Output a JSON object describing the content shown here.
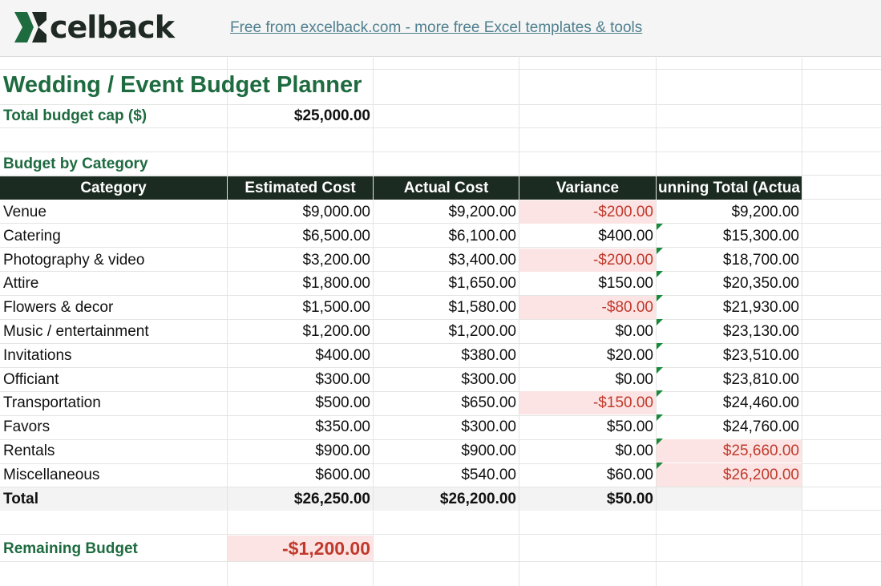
{
  "header": {
    "logo_text": "celback",
    "link_text": "Free from excelback.com - more free Excel templates & tools"
  },
  "sheet": {
    "title": "Wedding / Event Budget Planner",
    "cap_label": "Total budget cap ($)",
    "cap_value": "$25,000.00",
    "section_label": "Budget by Category",
    "columns": [
      "Category",
      "Estimated Cost",
      "Actual Cost",
      "Variance",
      "unning Total (Actua"
    ],
    "rows": [
      {
        "category": "Venue",
        "estimated": "$9,000.00",
        "actual": "$9,200.00",
        "variance": "-$200.00",
        "running": "$9,200.00",
        "var_neg": true,
        "run_over": false
      },
      {
        "category": "Catering",
        "estimated": "$6,500.00",
        "actual": "$6,100.00",
        "variance": "$400.00",
        "running": "$15,300.00",
        "var_neg": false,
        "run_over": false
      },
      {
        "category": "Photography & video",
        "estimated": "$3,200.00",
        "actual": "$3,400.00",
        "variance": "-$200.00",
        "running": "$18,700.00",
        "var_neg": true,
        "run_over": false
      },
      {
        "category": "Attire",
        "estimated": "$1,800.00",
        "actual": "$1,650.00",
        "variance": "$150.00",
        "running": "$20,350.00",
        "var_neg": false,
        "run_over": false
      },
      {
        "category": "Flowers & decor",
        "estimated": "$1,500.00",
        "actual": "$1,580.00",
        "variance": "-$80.00",
        "running": "$21,930.00",
        "var_neg": true,
        "run_over": false
      },
      {
        "category": "Music / entertainment",
        "estimated": "$1,200.00",
        "actual": "$1,200.00",
        "variance": "$0.00",
        "running": "$23,130.00",
        "var_neg": false,
        "run_over": false
      },
      {
        "category": "Invitations",
        "estimated": "$400.00",
        "actual": "$380.00",
        "variance": "$20.00",
        "running": "$23,510.00",
        "var_neg": false,
        "run_over": false
      },
      {
        "category": "Officiant",
        "estimated": "$300.00",
        "actual": "$300.00",
        "variance": "$0.00",
        "running": "$23,810.00",
        "var_neg": false,
        "run_over": false
      },
      {
        "category": "Transportation",
        "estimated": "$500.00",
        "actual": "$650.00",
        "variance": "-$150.00",
        "running": "$24,460.00",
        "var_neg": true,
        "run_over": false
      },
      {
        "category": "Favors",
        "estimated": "$350.00",
        "actual": "$300.00",
        "variance": "$50.00",
        "running": "$24,760.00",
        "var_neg": false,
        "run_over": false
      },
      {
        "category": "Rentals",
        "estimated": "$900.00",
        "actual": "$900.00",
        "variance": "$0.00",
        "running": "$25,660.00",
        "var_neg": false,
        "run_over": true
      },
      {
        "category": "Miscellaneous",
        "estimated": "$600.00",
        "actual": "$540.00",
        "variance": "$60.00",
        "running": "$26,200.00",
        "var_neg": false,
        "run_over": true
      }
    ],
    "total": {
      "label": "Total",
      "estimated": "$26,250.00",
      "actual": "$26,200.00",
      "variance": "$50.00"
    },
    "remaining_label": "Remaining Budget",
    "remaining_value": "-$1,200.00"
  },
  "colors": {
    "brand_green": "#1e6b40",
    "header_dark": "#1c2b22",
    "negative_red": "#c0392b",
    "negative_fill": "#fce4e4",
    "link": "#4f7f8f"
  }
}
